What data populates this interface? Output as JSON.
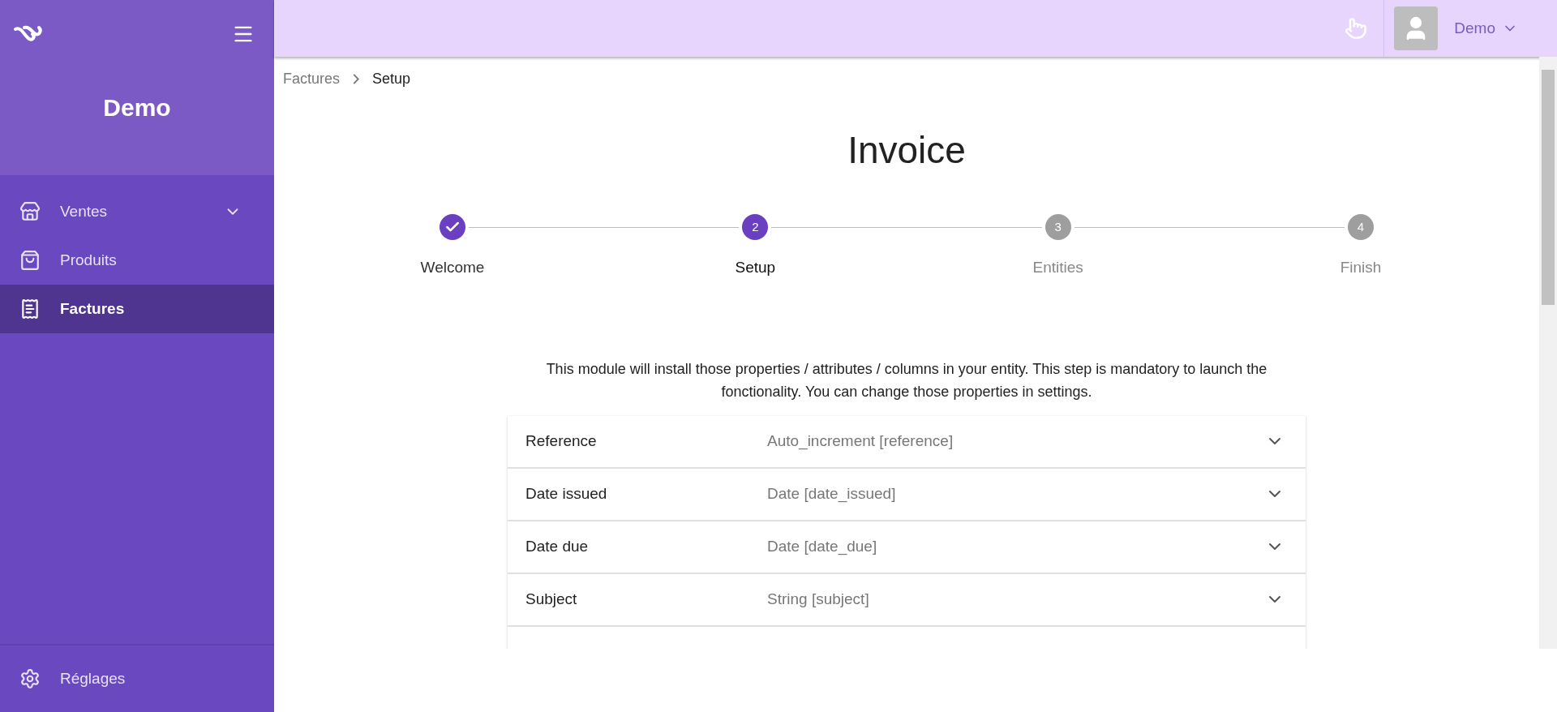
{
  "sidebar": {
    "title": "Demo",
    "items": [
      {
        "label": "Ventes",
        "expandable": true,
        "selected": false
      },
      {
        "label": "Produits",
        "expandable": false,
        "selected": false
      },
      {
        "label": "Factures",
        "expandable": false,
        "selected": true
      }
    ],
    "footer_item": {
      "label": "Réglages"
    }
  },
  "topbar": {
    "user": "Demo"
  },
  "breadcrumb": [
    "Factures",
    "Setup"
  ],
  "page_title": "Invoice",
  "stepper": [
    {
      "label": "Welcome",
      "done": true,
      "selected": false
    },
    {
      "label": "Setup",
      "number": "2",
      "done": false,
      "selected": true
    },
    {
      "label": "Entities",
      "number": "3",
      "done": false,
      "selected": false
    },
    {
      "label": "Finish",
      "number": "4",
      "done": false,
      "selected": false
    }
  ],
  "description": "This module will install those properties / attributes / columns in your entity. This step is mandatory to launch the fonctionality. You can change those properties in settings.",
  "properties": [
    {
      "name": "Reference",
      "type": "Auto_increment [reference]"
    },
    {
      "name": "Date issued",
      "type": "Date [date_issued]"
    },
    {
      "name": "Date due",
      "type": "Date [date_due]"
    },
    {
      "name": "Subject",
      "type": "String [subject]"
    }
  ]
}
